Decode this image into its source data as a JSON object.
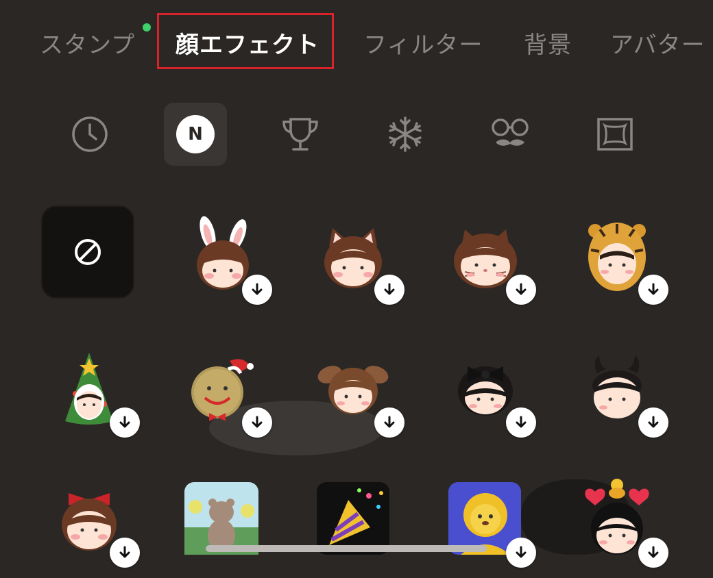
{
  "tabs": [
    {
      "label": "スタンプ",
      "has_dot": true
    },
    {
      "label": "顔エフェクト",
      "active": true
    },
    {
      "label": "フィルター"
    },
    {
      "label": "背景"
    },
    {
      "label": "アバター"
    }
  ],
  "categories": [
    {
      "icon": "clock-icon"
    },
    {
      "icon": "new-icon",
      "badge": "N",
      "selected": true
    },
    {
      "icon": "trophy-icon"
    },
    {
      "icon": "snowflake-icon"
    },
    {
      "icon": "glasses-mustache-icon"
    },
    {
      "icon": "frame-icon"
    }
  ],
  "effects": {
    "none_icon": "no-effect-icon",
    "items": [
      {
        "name": "bunny-ears-effect"
      },
      {
        "name": "cat-ears-effect"
      },
      {
        "name": "cat-whiskers-effect"
      },
      {
        "name": "tiger-hood-effect"
      },
      {
        "name": "christmas-tree-effect"
      },
      {
        "name": "gingerbread-effect"
      },
      {
        "name": "puppy-ears-effect"
      },
      {
        "name": "black-bow-effect"
      },
      {
        "name": "devil-horns-effect"
      },
      {
        "name": "red-bow-effect"
      },
      {
        "name": "cheerleader-bear-effect"
      },
      {
        "name": "party-popper-effect"
      },
      {
        "name": "lion-effect"
      },
      {
        "name": "hearts-chick-effect"
      }
    ]
  },
  "colors": {
    "background": "#2b2725",
    "active_tab": "#ffffff",
    "inactive_tab": "#8a8683",
    "highlight": "#d8232a",
    "notification_dot": "#3fcf6b"
  }
}
